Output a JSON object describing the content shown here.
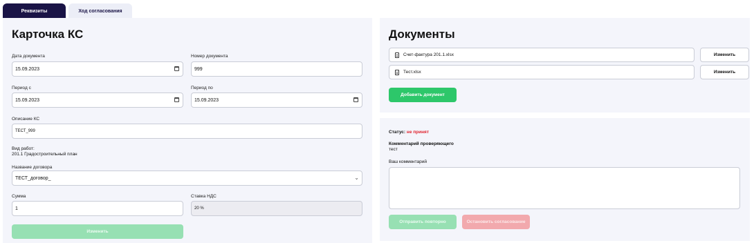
{
  "tabs": [
    {
      "label": "Реквизиты",
      "active": true
    },
    {
      "label": "Ход согласования",
      "active": false
    }
  ],
  "card": {
    "title": "Карточка КС",
    "doc_date": {
      "label": "Дата документа",
      "value": "15.09.2023"
    },
    "doc_number": {
      "label": "Номер документа",
      "value": "999"
    },
    "period_from": {
      "label": "Период с",
      "value": "15.09.2023"
    },
    "period_to": {
      "label": "Период по",
      "value": "15.09.2023"
    },
    "description": {
      "label": "Описание КС",
      "value": "ТЕСТ_999"
    },
    "work_type": {
      "label": "Вид работ:",
      "value": "201.1 Градостроительный план"
    },
    "contract": {
      "label": "Название договора",
      "value": "ТЕСТ_договор_"
    },
    "amount": {
      "label": "Сумма",
      "value": "1"
    },
    "vat": {
      "label": "Ставка НДС",
      "value": "20 %"
    },
    "edit_button": "Изменить"
  },
  "docs": {
    "title": "Документы",
    "files": [
      {
        "name": "Счет-фактура 201.1.xlsx",
        "button": "Изменить"
      },
      {
        "name": "Тест.xlsx",
        "button": "Изменить"
      }
    ],
    "add_button": "Добавить документ"
  },
  "review": {
    "status_label": "Статус:",
    "status_value": "не принят",
    "reviewer_comment_label": "Комментарий проверяющего",
    "reviewer_comment": "тест",
    "your_comment_label": "Ваш комментарий",
    "your_comment_value": "",
    "resend_button": "Отправить повторно",
    "stop_button": "Остановить согласование"
  },
  "colors": {
    "tab_active": "#1a1446",
    "panel_bg": "#f4f5fb",
    "accent_green": "#2dc76a",
    "status_red": "#e0242f"
  }
}
